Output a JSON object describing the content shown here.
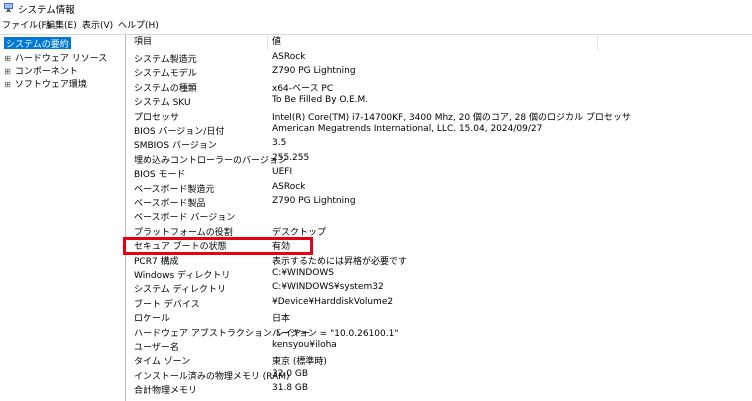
{
  "window": {
    "title": "システム情報"
  },
  "menu": [
    "ファイル(F)",
    "編集(E)",
    "表示(V)",
    "ヘルプ(H)"
  ],
  "tree": [
    {
      "label": "システムの要約",
      "expander": "",
      "selected": true
    },
    {
      "label": "ハードウェア リソース",
      "expander": "⊞",
      "selected": false
    },
    {
      "label": "コンポーネント",
      "expander": "⊞",
      "selected": false
    },
    {
      "label": "ソフトウェア環境",
      "expander": "⊞",
      "selected": false
    }
  ],
  "columns": {
    "item": "項目",
    "value": "値"
  },
  "rows": [
    [
      "システム製造元",
      "ASRock"
    ],
    [
      "システムモデル",
      "Z790 PG Lightning"
    ],
    [
      "システムの種類",
      "x64-ベース PC"
    ],
    [
      "システム SKU",
      "To Be Filled By O.E.M."
    ],
    [
      "プロセッサ",
      "Intel(R) Core(TM) i7-14700KF, 3400 Mhz, 20 個のコア, 28 個のロジカル プロセッサ"
    ],
    [
      "BIOS バージョン/日付",
      "American Megatrends International, LLC. 15.04, 2024/09/27"
    ],
    [
      "SMBIOS バージョン",
      "3.5"
    ],
    [
      "埋め込みコントローラーのバージョン",
      "255.255"
    ],
    [
      "BIOS モード",
      "UEFI"
    ],
    [
      "ベースボード製造元",
      "ASRock"
    ],
    [
      "ベースボード製品",
      "Z790 PG Lightning"
    ],
    [
      "ベースボード バージョン",
      ""
    ],
    [
      "プラットフォームの役割",
      "デスクトップ"
    ],
    [
      "セキュア ブートの状態",
      "有効"
    ],
    [
      "PCR7 構成",
      "表示するためには昇格が必要です"
    ],
    [
      "Windows ディレクトリ",
      "C:¥WINDOWS"
    ],
    [
      "システム ディレクトリ",
      "C:¥WINDOWS¥system32"
    ],
    [
      "ブート デバイス",
      "¥Device¥HarddiskVolume2"
    ],
    [
      "ロケール",
      "日本"
    ],
    [
      "ハードウェア アブストラクション レイヤー",
      "バージョン = \"10.0.26100.1\""
    ],
    [
      "ユーザー名",
      "kensyou¥iloha"
    ],
    [
      "タイム ゾーン",
      "東京 (標準時)"
    ],
    [
      "インストール済みの物理メモリ (RAM)",
      "32.0 GB"
    ],
    [
      "合計物理メモリ",
      "31.8 GB"
    ]
  ],
  "colors": {
    "selection": "#0078d7",
    "highlight": "#e60012"
  }
}
